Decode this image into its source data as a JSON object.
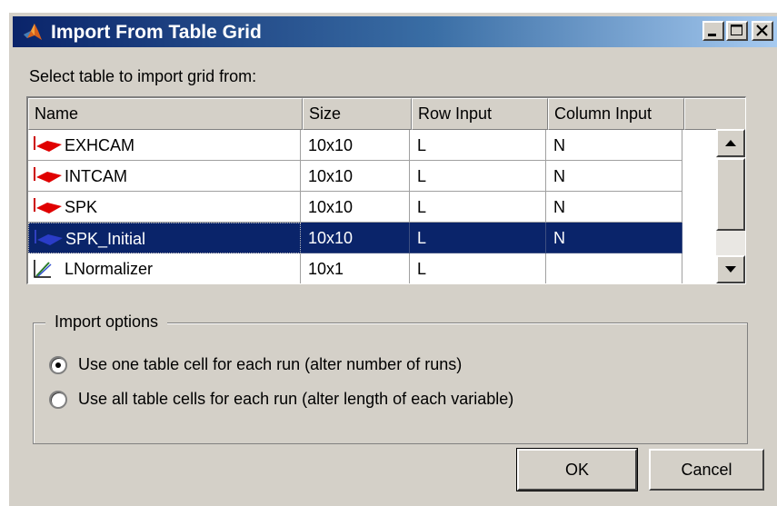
{
  "window": {
    "title": "Import From Table Grid",
    "controls": [
      "minimize-icon",
      "maximize-icon",
      "close-icon"
    ]
  },
  "prompt": "Select table to import grid from:",
  "table": {
    "columns": [
      "Name",
      "Size",
      "Row Input",
      "Column Input"
    ],
    "rows": [
      {
        "name": "EXHCAM",
        "size": "10x10",
        "row_input": "L",
        "column_input": "N",
        "icon": "table-icon",
        "selected": false
      },
      {
        "name": "INTCAM",
        "size": "10x10",
        "row_input": "L",
        "column_input": "N",
        "icon": "table-icon",
        "selected": false
      },
      {
        "name": "SPK",
        "size": "10x10",
        "row_input": "L",
        "column_input": "N",
        "icon": "table-icon",
        "selected": false
      },
      {
        "name": "SPK_Initial",
        "size": "10x10",
        "row_input": "L",
        "column_input": "N",
        "icon": "table-icon",
        "selected": true
      },
      {
        "name": "LNormalizer",
        "size": "10x1",
        "row_input": "L",
        "column_input": "",
        "icon": "normalizer-icon",
        "selected": false
      }
    ]
  },
  "import_options": {
    "legend": "Import options",
    "options": [
      {
        "label": "Use one table cell for each run (alter number of runs)",
        "checked": true
      },
      {
        "label": "Use all table cells for each run (alter length of each variable)",
        "checked": false
      }
    ]
  },
  "buttons": {
    "ok": "OK",
    "cancel": "Cancel"
  },
  "colors": {
    "selection": "#0a246a",
    "titlebar": "#0a246a",
    "dialog": "#d4d0c8"
  }
}
